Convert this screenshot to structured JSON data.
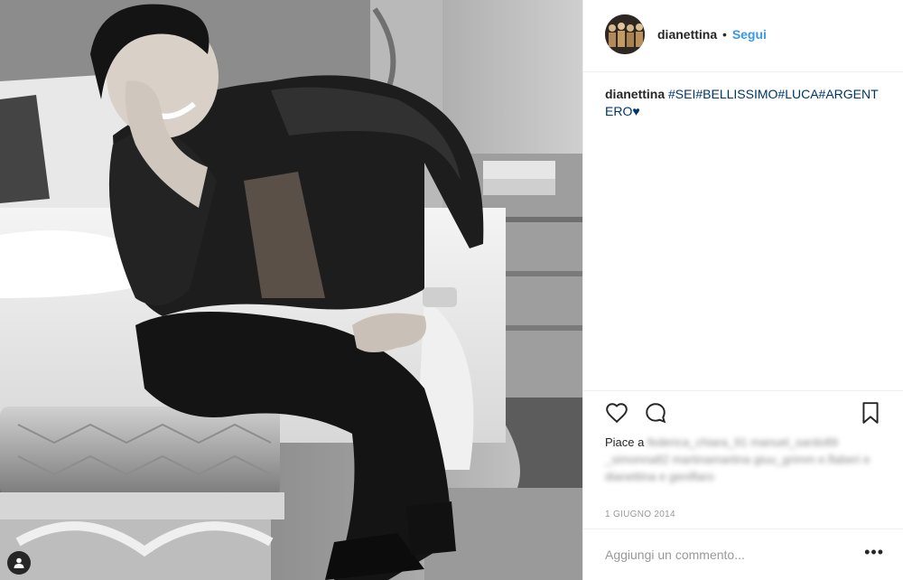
{
  "post": {
    "photo_icon": "user-tag-icon",
    "header": {
      "username": "dianettina",
      "separator": "•",
      "follow_label": "Segui"
    },
    "caption": {
      "username": "dianettina",
      "text": "#SEI#BELLISSIMO#LUCA#ARGENTERO♥"
    },
    "actions": {
      "like_icon": "heart-icon",
      "comment_icon": "comment-icon",
      "save_icon": "bookmark-icon"
    },
    "likes": {
      "prefix": "Piace a",
      "names_blurred": "federica_chiara_91 manuel_sardo89 _simonna82 martinamartina giuu_grimm e.flaberi e dianettina e geniflaro"
    },
    "date": "1 GIUGNO 2014",
    "comment": {
      "placeholder": "Aggiungi un commento...",
      "more_label": "•••"
    },
    "colors": {
      "accent": "#3897f0",
      "hashtag": "#003569"
    }
  }
}
